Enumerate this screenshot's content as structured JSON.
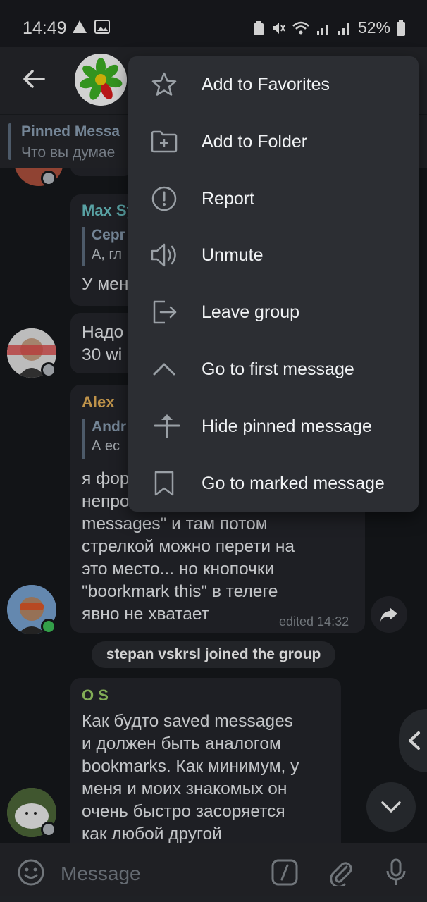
{
  "status_bar": {
    "time": "14:49",
    "battery": "52%"
  },
  "pinned": {
    "title": "Pinned Messa",
    "text": "Что вы думае"
  },
  "messages": [
    {
      "sender": "Max Sy",
      "quote_name": "Серг",
      "quote_text": "А, гл",
      "text": "У мен"
    },
    {
      "text_line1": "Надо",
      "text_line2": "30 wi"
    },
    {
      "sender": "Alex",
      "quote_name": "Andr",
      "quote_text": "А ес",
      "lines": [
        "я фор",
        "непро",
        "messages\" и там потом",
        "стрелкой можно перети на",
        "это место... но кнопочки",
        "\"boorkmark this\" в телеге",
        "явно не хватает"
      ],
      "edited": "edited 14:32"
    },
    {
      "sender": "O S",
      "lines": [
        "Как будто saved messages",
        "и должен быть аналогом",
        "bookmarks. Как минимум, у",
        "меня и моих знакомых он",
        "очень быстро засоряется",
        "как любой другой"
      ]
    }
  ],
  "system_message": "stepan vskrsl joined the group",
  "input": {
    "placeholder": "Message"
  },
  "menu": {
    "items": [
      {
        "label": "Add to Favorites",
        "icon": "star-icon"
      },
      {
        "label": "Add to Folder",
        "icon": "folder-plus-icon"
      },
      {
        "label": "Report",
        "icon": "report-icon"
      },
      {
        "label": "Unmute",
        "icon": "speaker-icon"
      },
      {
        "label": "Leave group",
        "icon": "leave-icon"
      },
      {
        "label": "Go to first message",
        "icon": "chevron-up-icon"
      },
      {
        "label": "Hide pinned message",
        "icon": "unpin-icon"
      },
      {
        "label": "Go to marked message",
        "icon": "bookmark-icon"
      }
    ]
  },
  "colors": {
    "background": "#17191d",
    "bubble": "#25272c",
    "menu": "#2c2e33",
    "name_max": "#6cc5c7",
    "name_alex": "#e8b35b",
    "name_os": "#9fd36a",
    "online": "#3fc35a"
  }
}
